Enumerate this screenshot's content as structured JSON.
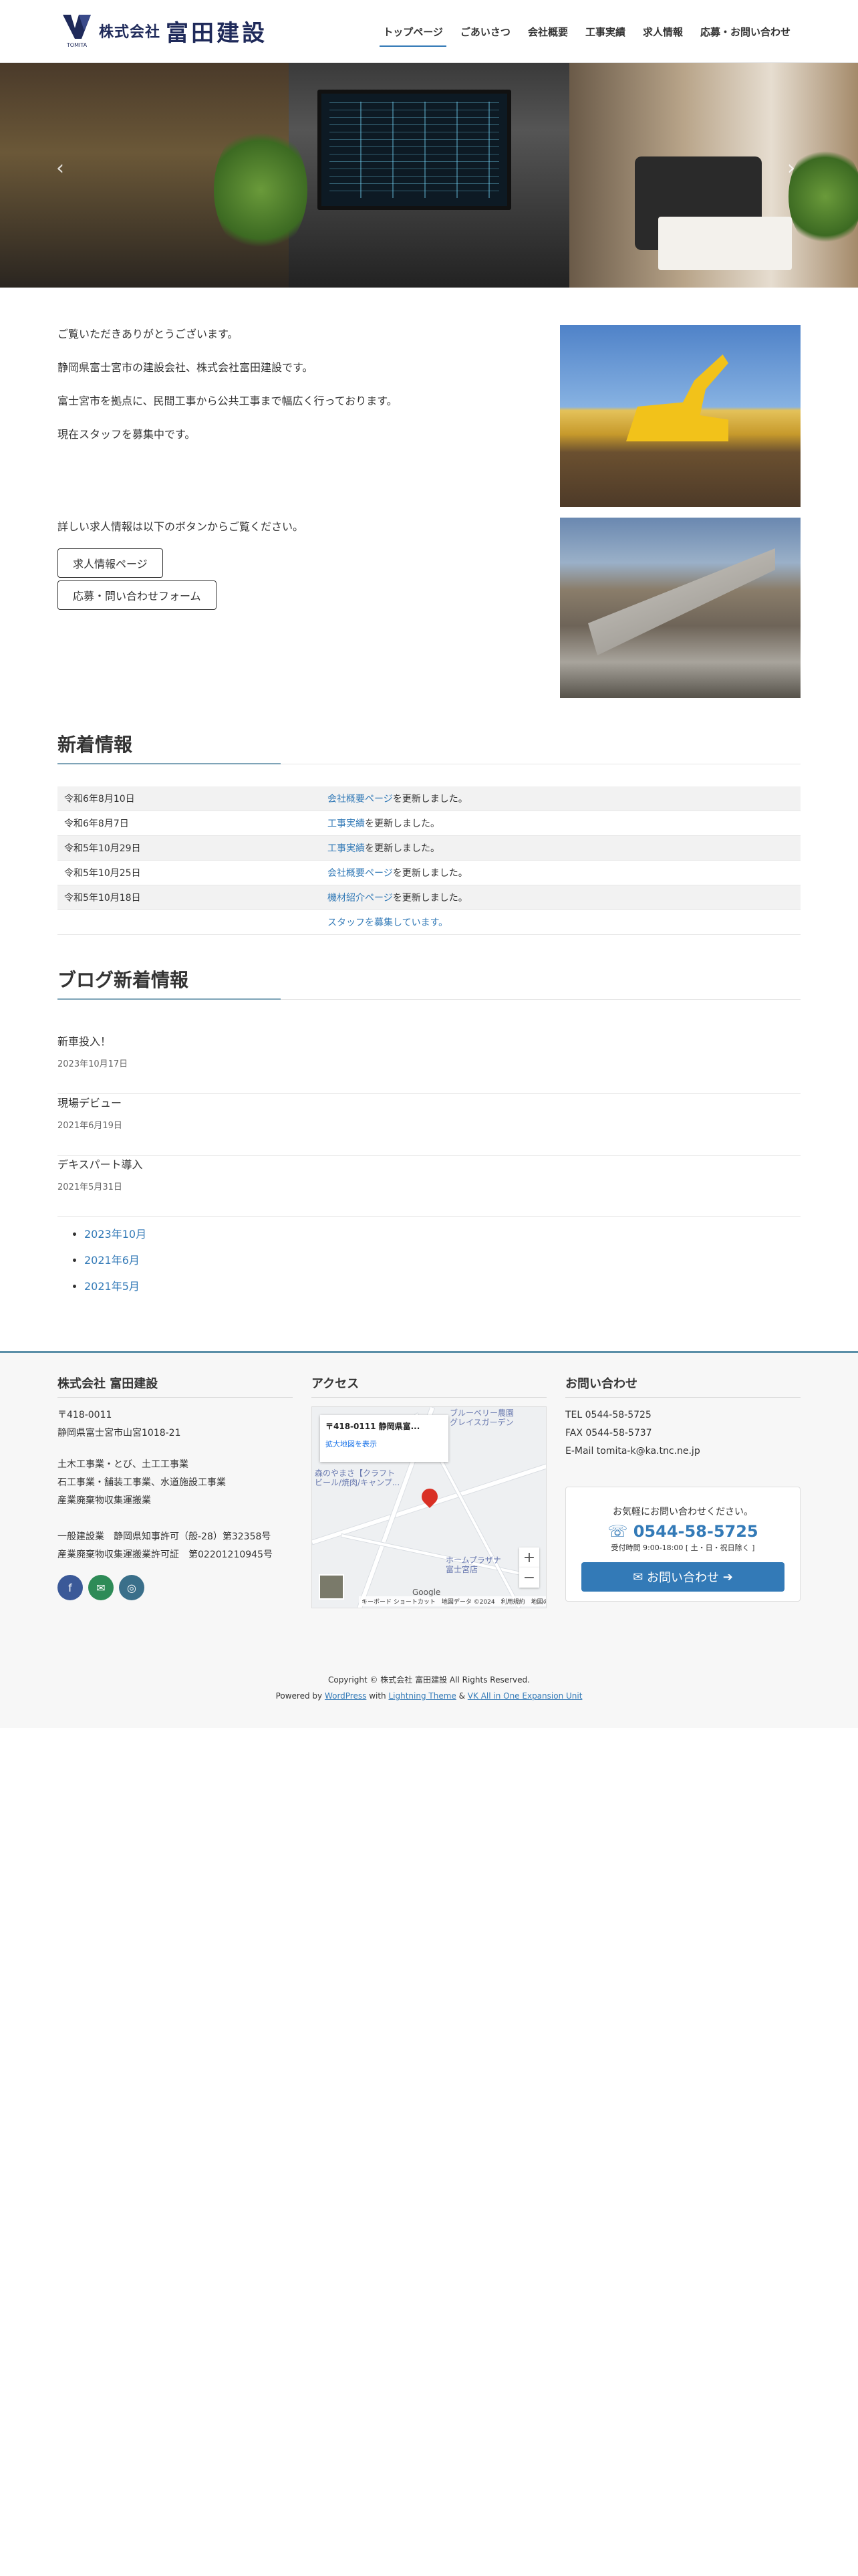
{
  "header": {
    "logo_small": "株式会社",
    "logo_big": "富田建設",
    "logo_sub": "TOMITA",
    "nav": [
      "トップページ",
      "ごあいさつ",
      "会社概要",
      "工事実績",
      "求人情報",
      "応募・お問い合わせ"
    ]
  },
  "hero": {
    "prev": "‹",
    "next": "›",
    "slide_index": 1,
    "slide_count": 2
  },
  "intro": {
    "p1": "ご覧いただきありがとうございます。",
    "p2": "静岡県富士宮市の建設会社、株式会社富田建設です。",
    "p3": "富士宮市を拠点に、民間工事から公共工事まで幅広く行っております。",
    "p4": "現在スタッフを募集中です。",
    "detail": "詳しい求人情報は以下のボタンからご覧ください。",
    "btn_jobs": "求人情報ページ",
    "btn_contact": "応募・問い合わせフォーム"
  },
  "news": {
    "title": "新着情報",
    "items": [
      {
        "date": "令和6年8月10日",
        "link": "会社概要ページ",
        "rest": "を更新しました。"
      },
      {
        "date": "令和6年8月7日",
        "link": "工事実績",
        "rest": "を更新しました。"
      },
      {
        "date": "令和5年10月29日",
        "link": "工事実績",
        "rest": "を更新しました。"
      },
      {
        "date": "令和5年10月25日",
        "link": "会社概要ページ",
        "rest": "を更新しました。"
      },
      {
        "date": "令和5年10月18日",
        "link": "機材紹介ページ",
        "rest": "を更新しました。"
      },
      {
        "date": "",
        "link": "スタッフを募集しています。",
        "rest": ""
      }
    ]
  },
  "blog": {
    "title": "ブログ新着情報",
    "posts": [
      {
        "title": "新車投入！",
        "date": "2023年10月17日"
      },
      {
        "title": "現場デビュー",
        "date": "2021年6月19日"
      },
      {
        "title": "デキスパート導入",
        "date": "2021年5月31日"
      }
    ],
    "archives": [
      "2023年10月",
      "2021年6月",
      "2021年5月"
    ]
  },
  "footer": {
    "company_title": "株式会社 富田建設",
    "address": "〒418-0011\n静岡県富士宮市山宮1018-21",
    "business": "土木工事業・とび、土工工事業\n石工事業・舗装工事業、水道施設工事業\n産業廃棄物収集運搬業",
    "licenses": "一般建設業　静岡県知事許可（般-28）第32358号\n産業廃棄物収集運搬業許可証　第02201210945号",
    "access_title": "アクセス",
    "map": {
      "card_title": "〒418-0111 静岡県富...",
      "card_link": "拡大地図を表示",
      "label1": "ブルーベリー農園\nグレイスガーデン",
      "label2": "森のやまさ【クラフト\nビール/焼肉/キャンプ...",
      "label3": "ホームプラザナ\n富士宮店",
      "footer": "キーボード ショートカット　地図データ ©2024　利用規約　地図の誤りを報告する",
      "google": "Google"
    },
    "contact_title": "お問い合わせ",
    "contact": "TEL 0544-58-5725\nFAX 0544-58-5737\nE-Mail tomita-k@ka.tnc.ne.jp",
    "cta_lead": "お気軽にお問い合わせください。",
    "cta_tel": "0544-58-5725",
    "cta_hours": "受付時間 9:00-18:00 [ 土・日・祝日除く ]",
    "cta_button": "お問い合わせ",
    "copyright": "Copyright © 株式会社 富田建設 All Rights Reserved.",
    "powered_pre": "Powered by ",
    "powered_wp": "WordPress",
    "powered_with": " with ",
    "powered_theme": "Lightning Theme",
    "powered_amp": " & ",
    "powered_vk": "VK All in One Expansion Unit"
  },
  "colors": {
    "accent": "#337ab7",
    "navy": "#1f2a5a",
    "footer_bg": "#f7f7f7",
    "facebook": "#3b5998",
    "mail": "#2e8b57",
    "instagram": "#3a6f8a"
  }
}
